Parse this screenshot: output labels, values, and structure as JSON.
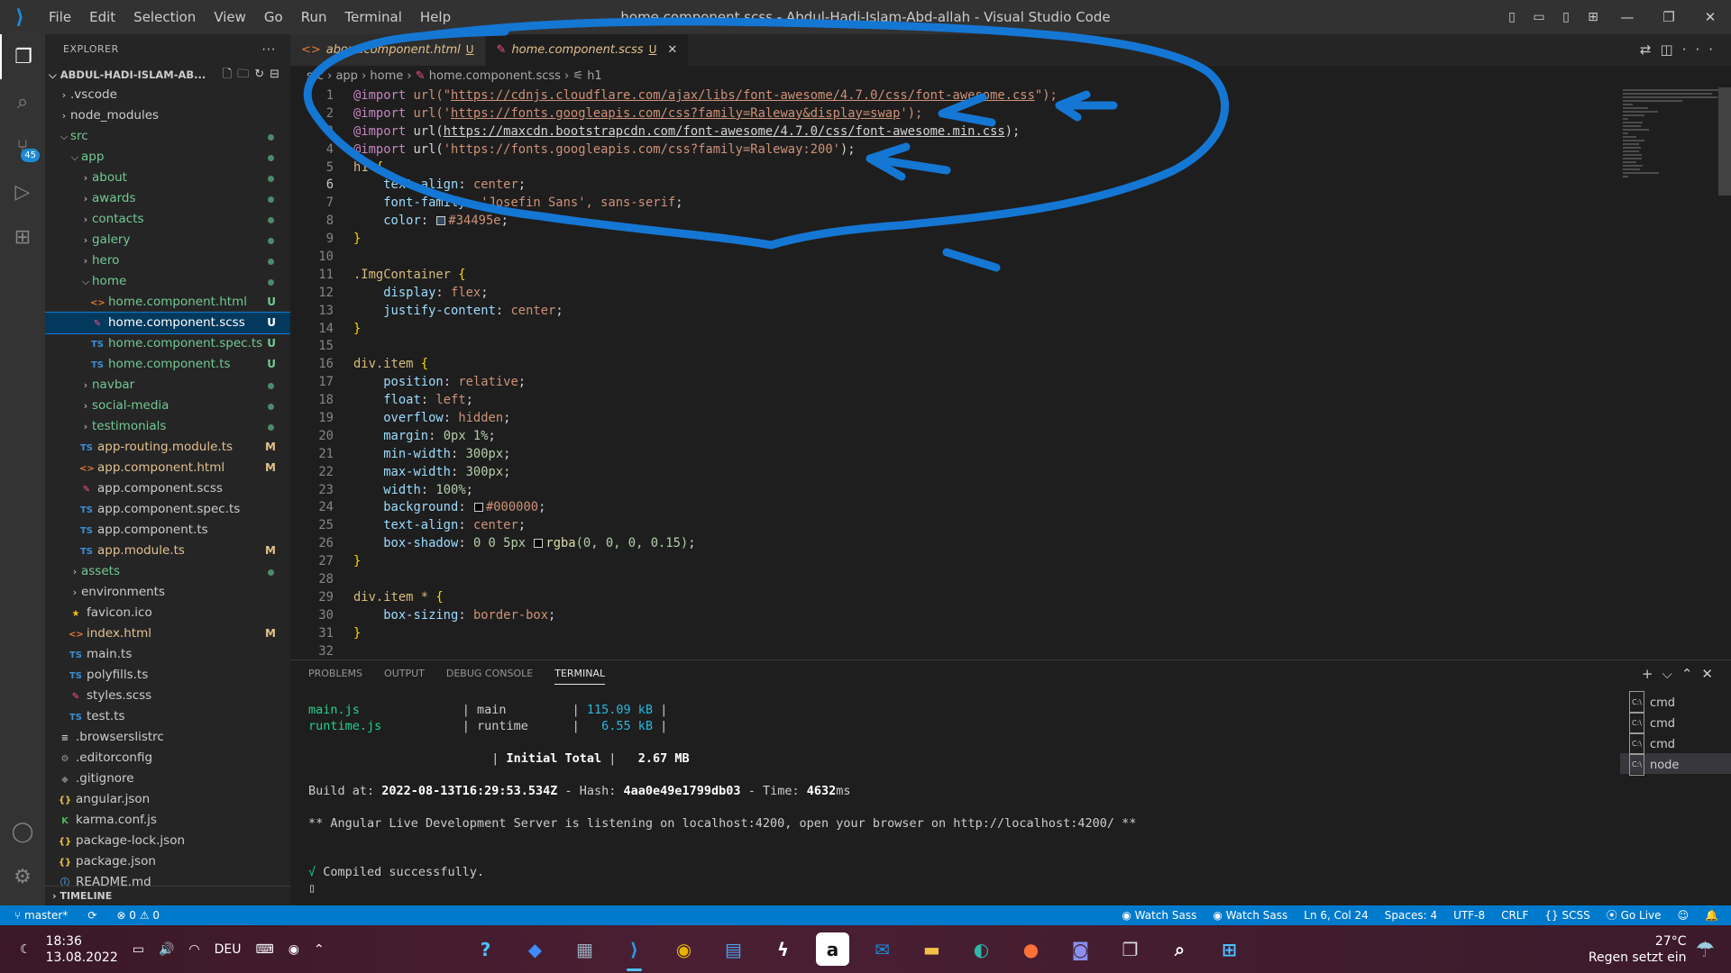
{
  "window": {
    "title": "home.component.scss - Abdul-Hadi-Islam-Abd-allah - Visual Studio Code",
    "menu": [
      "File",
      "Edit",
      "Selection",
      "View",
      "Go",
      "Run",
      "Terminal",
      "Help"
    ]
  },
  "activity": {
    "scm_badge": "45"
  },
  "explorer": {
    "header": "EXPLORER",
    "project": "ABDUL-HADI-ISLAM-AB...",
    "timeline": "TIMELINE",
    "tree": [
      {
        "label": ".vscode",
        "type": "folder",
        "depth": 1,
        "open": false
      },
      {
        "label": "node_modules",
        "type": "folder",
        "depth": 1,
        "open": false
      },
      {
        "label": "src",
        "type": "folder",
        "depth": 1,
        "open": true,
        "dot": true
      },
      {
        "label": "app",
        "type": "folder",
        "depth": 2,
        "open": true,
        "dot": true
      },
      {
        "label": "about",
        "type": "folder",
        "depth": 3,
        "open": false,
        "dot": true
      },
      {
        "label": "awards",
        "type": "folder",
        "depth": 3,
        "open": false,
        "dot": true
      },
      {
        "label": "contacts",
        "type": "folder",
        "depth": 3,
        "open": false,
        "dot": true
      },
      {
        "label": "galery",
        "type": "folder",
        "depth": 3,
        "open": false,
        "dot": true
      },
      {
        "label": "hero",
        "type": "folder",
        "depth": 3,
        "open": false,
        "dot": true
      },
      {
        "label": "home",
        "type": "folder",
        "depth": 3,
        "open": true,
        "dot": true
      },
      {
        "label": "home.component.html",
        "type": "html",
        "depth": 4,
        "status": "U"
      },
      {
        "label": "home.component.scss",
        "type": "scss",
        "depth": 4,
        "status": "U",
        "selected": true
      },
      {
        "label": "home.component.spec.ts",
        "type": "ts",
        "depth": 4,
        "status": "U"
      },
      {
        "label": "home.component.ts",
        "type": "ts",
        "depth": 4,
        "status": "U"
      },
      {
        "label": "navbar",
        "type": "folder",
        "depth": 3,
        "open": false,
        "dot": true
      },
      {
        "label": "social-media",
        "type": "folder",
        "depth": 3,
        "open": false,
        "dot": true
      },
      {
        "label": "testimonials",
        "type": "folder",
        "depth": 3,
        "open": false,
        "dot": true
      },
      {
        "label": "app-routing.module.ts",
        "type": "ts",
        "depth": 3,
        "status": "M"
      },
      {
        "label": "app.component.html",
        "type": "html",
        "depth": 3,
        "status": "M"
      },
      {
        "label": "app.component.scss",
        "type": "scss",
        "depth": 3
      },
      {
        "label": "app.component.spec.ts",
        "type": "ts",
        "depth": 3
      },
      {
        "label": "app.component.ts",
        "type": "ts",
        "depth": 3
      },
      {
        "label": "app.module.ts",
        "type": "ts",
        "depth": 3,
        "status": "M"
      },
      {
        "label": "assets",
        "type": "folder",
        "depth": 2,
        "open": false,
        "dot": true
      },
      {
        "label": "environments",
        "type": "folder",
        "depth": 2,
        "open": false
      },
      {
        "label": "favicon.ico",
        "type": "star",
        "depth": 2
      },
      {
        "label": "index.html",
        "type": "html",
        "depth": 2,
        "status": "M"
      },
      {
        "label": "main.ts",
        "type": "ts",
        "depth": 2
      },
      {
        "label": "polyfills.ts",
        "type": "ts",
        "depth": 2
      },
      {
        "label": "styles.scss",
        "type": "scss",
        "depth": 2
      },
      {
        "label": "test.ts",
        "type": "ts",
        "depth": 2
      },
      {
        "label": ".browserslistrc",
        "type": "list",
        "depth": 1
      },
      {
        "label": ".editorconfig",
        "type": "gear",
        "depth": 1
      },
      {
        "label": ".gitignore",
        "type": "git",
        "depth": 1
      },
      {
        "label": "angular.json",
        "type": "json",
        "depth": 1
      },
      {
        "label": "karma.conf.js",
        "type": "karma",
        "depth": 1
      },
      {
        "label": "package-lock.json",
        "type": "json",
        "depth": 1
      },
      {
        "label": "package.json",
        "type": "json",
        "depth": 1
      },
      {
        "label": "README.md",
        "type": "info",
        "depth": 1
      }
    ]
  },
  "tabs": [
    {
      "label": "about.component.html",
      "status": "U",
      "active": false
    },
    {
      "label": "home.component.scss",
      "status": "U",
      "active": true
    }
  ],
  "breadcrumb": {
    "p1": "src",
    "p2": "app",
    "p3": "home",
    "p4": "home.component.scss",
    "p5": "h1"
  },
  "code": {
    "l1": {
      "a": "@import",
      "b": " url(\"",
      "c": "https://cdnjs.cloudflare.com/ajax/libs/font-awesome/4.7.0/css/font-awesome.css",
      "d": "\");"
    },
    "l2": {
      "a": "@import",
      "b": " url('",
      "c": "https://fonts.googleapis.com/css?family=Raleway&display=swap",
      "d": "');"
    },
    "l3": {
      "a": "@import",
      "b": " url(",
      "c": "https://maxcdn.bootstrapcdn.com/font-awesome/4.7.0/css/font-awesome.min.css",
      "d": ");"
    },
    "l4": {
      "a": "@import",
      "b": " url(",
      "c": "'https://fonts.googleapis.com/css?family=Raleway:200'",
      "d": ");"
    },
    "l5": "h1",
    "l6": {
      "p": "text-align",
      "v": "center"
    },
    "l7": {
      "p": "font-family",
      "v": "'Josefin Sans', sans-serif"
    },
    "l8": {
      "p": "color",
      "v": "#34495e",
      "sw": "#34495e"
    },
    "l11": ".ImgContainer",
    "l12": {
      "p": "display",
      "v": "flex"
    },
    "l13": {
      "p": "justify-content",
      "v": "center"
    },
    "l16": "div.item",
    "l17": {
      "p": "position",
      "v": "relative"
    },
    "l18": {
      "p": "float",
      "v": "left"
    },
    "l19": {
      "p": "overflow",
      "v": "hidden"
    },
    "l20": {
      "p": "margin",
      "v": "0px 1%"
    },
    "l21": {
      "p": "min-width",
      "v": "300px"
    },
    "l22": {
      "p": "max-width",
      "v": "300px"
    },
    "l23": {
      "p": "width",
      "v": "100%"
    },
    "l24": {
      "p": "background",
      "v": "#000000",
      "sw": "#000000"
    },
    "l25": {
      "p": "text-align",
      "v": "center"
    },
    "l26": {
      "p": "box-shadow",
      "v1": "0 0 5px ",
      "f": "rgba",
      "v2": "(0, 0, 0, 0.15)",
      "sw": "#000000"
    },
    "l29": "div.item *",
    "l30": {
      "p": "box-sizing",
      "v": "border-box"
    }
  },
  "panel": {
    "tabs": [
      "PROBLEMS",
      "OUTPUT",
      "DEBUG CONSOLE",
      "TERMINAL"
    ],
    "terminals": [
      "cmd",
      "cmd",
      "cmd",
      "node"
    ],
    "lines": {
      "r1a": "main.js",
      "r1b": "| main",
      "r1c": "| ",
      "r1d": "115.09 kB",
      "r1e": " |",
      "r2a": "runtime.js",
      "r2b": "| runtime",
      "r2c": "| ",
      "r2d": "  6.55 kB",
      "r2e": " |",
      "r3a": "| ",
      "r3b": "Initial Total",
      "r3c": " |   ",
      "r3d": "2.67 MB",
      "b1": "Build at: ",
      "b2": "2022-08-13T16:29:53.534Z",
      "b3": " - Hash: ",
      "b4": "4aa0e49e1799db03",
      "b5": " - Time: ",
      "b6": "4632",
      "b7": "ms",
      "serve": "** Angular Live Development Server is listening on localhost:4200, open your browser on http://localhost:4200/ **",
      "ok1": "√",
      "ok2": " Compiled successfully."
    }
  },
  "status": {
    "branch": "master*",
    "errors": "0",
    "warnings": "0",
    "watch1": "Watch Sass",
    "watch2": "Watch Sass",
    "pos": "Ln 6, Col 24",
    "spaces": "Spaces: 4",
    "enc": "UTF-8",
    "eol": "CRLF",
    "lang": "SCSS",
    "golive": "Go Live"
  },
  "taskbar": {
    "time": "18:36",
    "date": "13.08.2022",
    "lang": "DEU",
    "temp": "27°C",
    "weather": "Regen setzt ein"
  }
}
